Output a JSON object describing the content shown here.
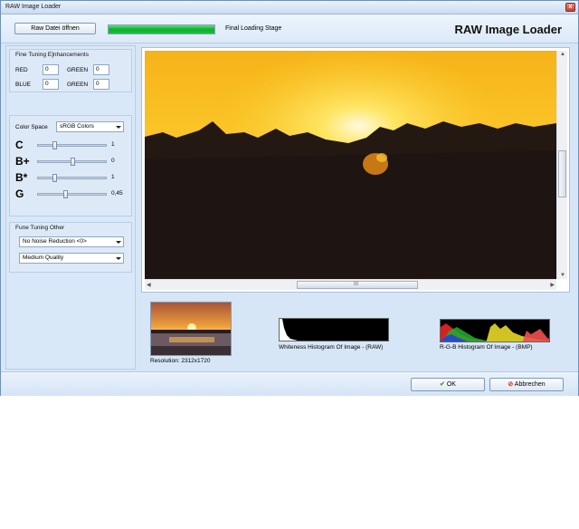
{
  "window": {
    "title": "RAW Image Loader",
    "close_glyph": "x"
  },
  "toolbar": {
    "open_button": "Raw Datei öffnen",
    "progress_fraction": 1.0,
    "stage_text": "Final Loading Stage",
    "app_title": "RAW Image Loader",
    "progress_color": "#11c33a"
  },
  "fine_tuning": {
    "title": "Fine Tuning E]nhancements",
    "red_label": "RED",
    "red_value": "0",
    "green_label": "GREEN",
    "green_value": "0",
    "blue_label": "BLUE",
    "blue_value": "0",
    "green2_label": "GREEN",
    "green2_value": "0"
  },
  "color_space": {
    "label": "Color Space",
    "selected": "sRGB Colors"
  },
  "sliders": [
    {
      "letter": "C",
      "value": "1",
      "level": 0.25
    },
    {
      "letter": "B+",
      "value": "0",
      "level": 0.5
    },
    {
      "letter": "B*",
      "value": "1",
      "level": 0.25
    },
    {
      "letter": "G",
      "value": "0,45",
      "level": 0.4
    }
  ],
  "other": {
    "title": "Fune Tuning Other",
    "noise_selected": "No Noise Reduction <0>",
    "quality_selected": "Medium Quality"
  },
  "thumbnails": {
    "resolution_text": "Resolution: 2312x1720",
    "whiteness_caption": "Whiteness Histogram Of Image - (RAW)",
    "rgb_caption": "R-G-B Histogram Of Image - (BMP)"
  },
  "scroll": {
    "h_thumb_glyph": "III"
  },
  "footer": {
    "ok_label": "OK",
    "cancel_label": "Abbrechen"
  }
}
